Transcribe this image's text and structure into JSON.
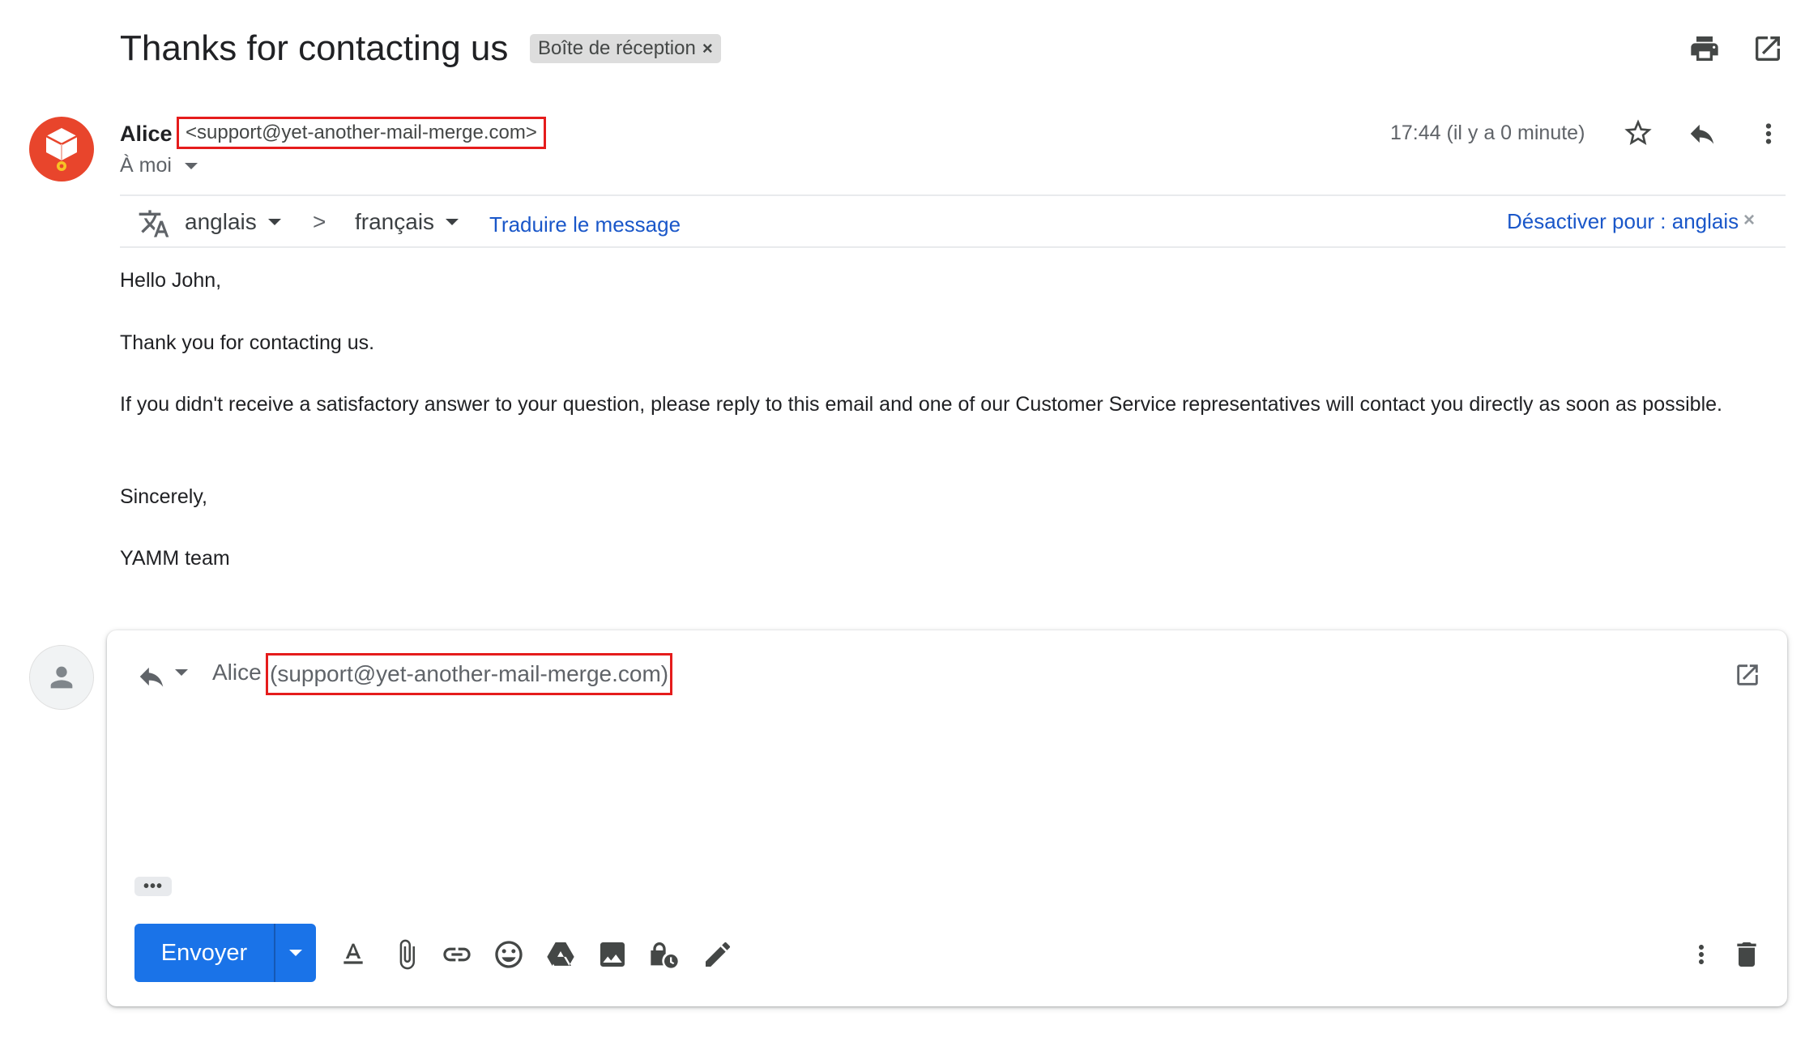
{
  "email": {
    "subject": "Thanks for contacting us",
    "label": "Boîte de réception",
    "label_close": "×",
    "sender_name": "Alice",
    "sender_email": "<support@yet-another-mail-merge.com>",
    "to": "À moi",
    "time": "17:44 (il y a 0 minute)"
  },
  "translate": {
    "from_lang": "anglais",
    "arrow": ">",
    "to_lang": "français",
    "translate_link": "Traduire le message",
    "disable_link": "Désactiver pour : anglais",
    "disable_close": "×"
  },
  "body": {
    "greeting": "Hello John,",
    "line1": "Thank you for contacting us.",
    "line2": "If you didn't receive a satisfactory answer to your question, please reply to this email and one of our Customer Service representatives will contact you directly as soon as possible.",
    "closing": "Sincerely,",
    "signature": "YAMM team"
  },
  "reply": {
    "to_name": "Alice",
    "to_email": "(support@yet-another-mail-merge.com)",
    "ellipsis": "•••",
    "send_label": "Envoyer"
  },
  "icons": {
    "print": "print-icon",
    "open_new_window": "open-in-new-icon",
    "star": "star-icon",
    "reply": "reply-icon",
    "more": "more-vert-icon",
    "translate": "translate-icon",
    "format": "format-text-icon",
    "attach": "paperclip-icon",
    "link": "link-icon",
    "emoji": "emoji-icon",
    "drive": "drive-icon",
    "photo": "photo-icon",
    "confidential": "confidential-mode-icon",
    "signature": "signature-pen-icon",
    "delete": "trash-icon"
  },
  "colors": {
    "accent_blue": "#1a73e8",
    "link_blue": "#1a57c9",
    "highlight_red": "#e51c1c",
    "avatar_orange": "#e8452c"
  }
}
